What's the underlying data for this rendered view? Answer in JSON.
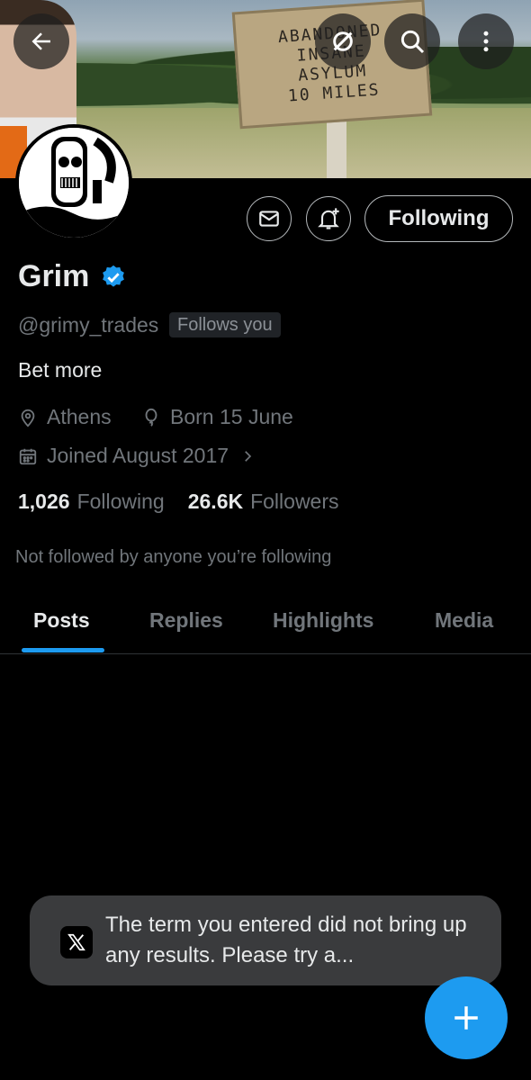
{
  "banner": {
    "sign_lines": [
      "ABANDONED",
      "INSANE",
      "ASYLUM",
      "10 MILES"
    ]
  },
  "profile": {
    "name": "Grim",
    "handle": "@grimy_trades",
    "follows_you": "Follows you",
    "bio": "Bet more",
    "location": "Athens",
    "birthday": "Born 15 June",
    "joined": "Joined August 2017",
    "following_count": "1,026",
    "following_label": "Following",
    "followers_count": "26.6K",
    "followers_label": "Followers",
    "mutuals_note": "Not followed by anyone you’re following"
  },
  "actions": {
    "follow_button_label": "Following"
  },
  "tabs": [
    {
      "label": "Posts",
      "active": true
    },
    {
      "label": "Replies",
      "active": false
    },
    {
      "label": "Highlights",
      "active": false
    },
    {
      "label": "Media",
      "active": false
    }
  ],
  "toast": {
    "message": "The term you entered did not bring up any results. Please try a..."
  },
  "colors": {
    "accent": "#1d9bf0",
    "background": "#000000",
    "muted_text": "#71767b",
    "verified": "#1d9bf0"
  },
  "icons": [
    "back-arrow-icon",
    "translate-off-icon",
    "search-icon",
    "more-vertical-icon",
    "mail-icon",
    "bell-plus-icon",
    "verified-badge-icon",
    "location-pin-icon",
    "balloon-icon",
    "calendar-icon",
    "chevron-right-icon",
    "x-logo-icon",
    "plus-icon"
  ]
}
